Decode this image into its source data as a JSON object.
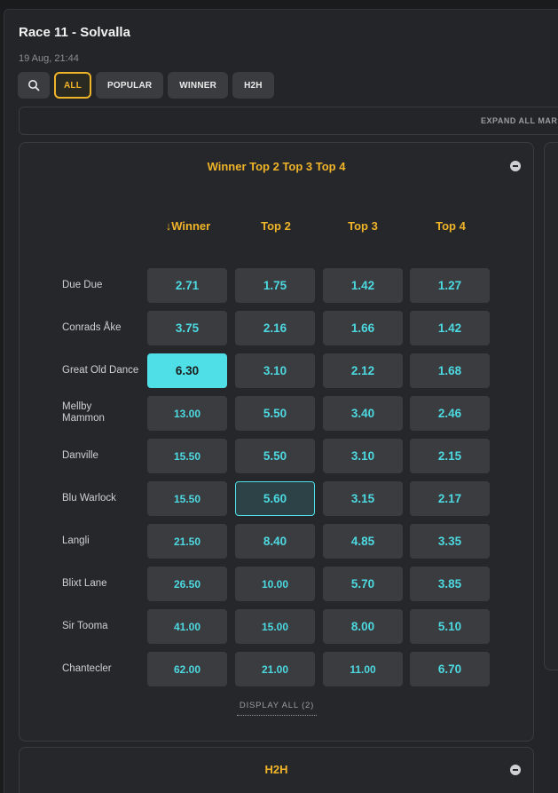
{
  "header": {
    "title": "Race 11 - Solvalla",
    "date": "19 Aug, 21:44"
  },
  "filters": [
    {
      "label": "ALL",
      "active": true
    },
    {
      "label": "POPULAR",
      "active": false
    },
    {
      "label": "WINNER",
      "active": false
    },
    {
      "label": "H2H",
      "active": false
    }
  ],
  "expand_all": "EXPAND ALL MAR",
  "market": {
    "title": "Winner Top 2 Top 3 Top 4",
    "columns": [
      "↓Winner",
      "Top 2",
      "Top 3",
      "Top 4"
    ],
    "rows": [
      {
        "name": "Due Due",
        "odds": [
          "2.71",
          "1.75",
          "1.42",
          "1.27"
        ]
      },
      {
        "name": "Conrads Åke",
        "odds": [
          "3.75",
          "2.16",
          "1.66",
          "1.42"
        ]
      },
      {
        "name": "Great Old Dance",
        "odds": [
          "6.30",
          "3.10",
          "2.12",
          "1.68"
        ]
      },
      {
        "name": "Mellby Mammon",
        "odds": [
          "13.00",
          "5.50",
          "3.40",
          "2.46"
        ]
      },
      {
        "name": "Danville",
        "odds": [
          "15.50",
          "5.50",
          "3.10",
          "2.15"
        ]
      },
      {
        "name": "Blu Warlock",
        "odds": [
          "15.50",
          "5.60",
          "3.15",
          "2.17"
        ]
      },
      {
        "name": "Langli",
        "odds": [
          "21.50",
          "8.40",
          "4.85",
          "3.35"
        ]
      },
      {
        "name": "Blixt Lane",
        "odds": [
          "26.50",
          "10.00",
          "5.70",
          "3.85"
        ]
      },
      {
        "name": "Sir Tooma",
        "odds": [
          "41.00",
          "15.00",
          "8.00",
          "5.10"
        ]
      },
      {
        "name": "Chantecler",
        "odds": [
          "62.00",
          "21.00",
          "11.00",
          "6.70"
        ]
      }
    ],
    "display_all": "DISPLAY ALL (2)"
  },
  "h2h_panel": {
    "title": "H2H"
  },
  "colors": {
    "accent": "#f0b429",
    "odds": "#4dd9e0",
    "selected": "#4fdfe6"
  }
}
